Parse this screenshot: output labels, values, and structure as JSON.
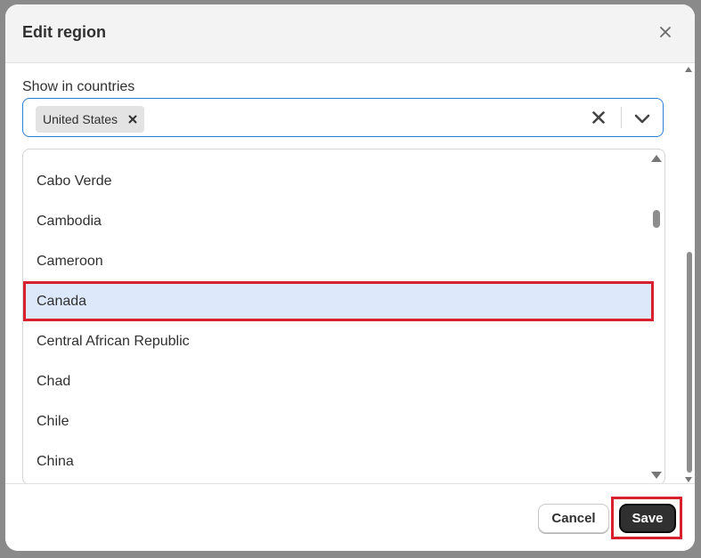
{
  "modal": {
    "title": "Edit region",
    "close_icon": "close-icon"
  },
  "field": {
    "label": "Show in countries",
    "chips": [
      {
        "label": "United States",
        "remove_icon": "remove-chip-icon"
      }
    ],
    "clear_icon": "clear-icon",
    "chevron_icon": "chevron-down-icon"
  },
  "dropdown": {
    "options": [
      {
        "label": "Cabo Verde",
        "selected": false
      },
      {
        "label": "Cambodia",
        "selected": false
      },
      {
        "label": "Cameroon",
        "selected": false
      },
      {
        "label": "Canada",
        "selected": true
      },
      {
        "label": "Central African Republic",
        "selected": false
      },
      {
        "label": "Chad",
        "selected": false
      },
      {
        "label": "Chile",
        "selected": false
      },
      {
        "label": "China",
        "selected": false
      }
    ]
  },
  "footer": {
    "cancel_label": "Cancel",
    "save_label": "Save"
  },
  "colors": {
    "primary_button": "#303030",
    "focus_border": "#2f7fd6",
    "selected_option_bg": "#dde9fb",
    "highlight_annotation": "#d8202e"
  }
}
